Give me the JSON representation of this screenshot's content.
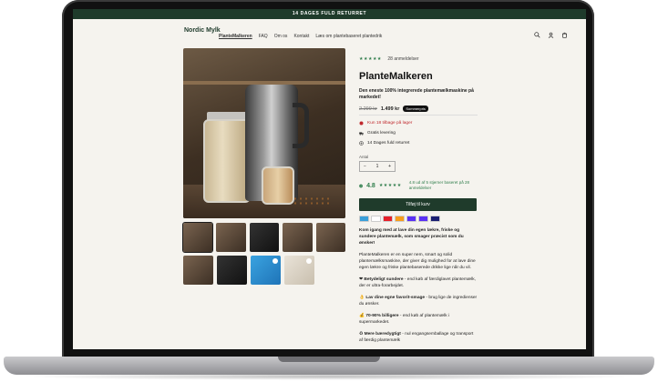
{
  "announcement": "14 DAGES FULD RETURRET",
  "logo": "Nordic Mylk",
  "nav": [
    "PlanteMalkeren",
    "FAQ",
    "Om os",
    "Kontakt",
    "Læs om plantebaseret plantedrik"
  ],
  "icons": [
    "search-icon",
    "account-icon",
    "cart-icon"
  ],
  "product": {
    "stars": "★★★★★",
    "review_count": "28 anmeldelser",
    "title": "PlanteMalkeren",
    "subtitle": "Den eneste 100% integrerede plantemælkmaskine på markedet!",
    "price_old": "2.299 kr",
    "price_new": "1.499 kr",
    "sale_badge": "Sommerpris",
    "features": [
      {
        "icon": "dot-icon",
        "text": "Kun 18 tilbage på lager"
      },
      {
        "icon": "truck-icon",
        "text": "Gratis levering"
      },
      {
        "icon": "return-icon",
        "text": "14 Dages fuld returret"
      }
    ],
    "quantity_label": "Antal",
    "quantity_value": "1",
    "rating_score": "4.8",
    "rating_stars": "★★★★★",
    "rating_text": "4.8 ud af 5 stjerner baseret på 28 anmeldelser",
    "cta_label": "Tilføj til kurv",
    "description_intro": "Kom igang med at lave din egen lækre, friske og sundere plantemælk, som smager præcist som du ønsker!",
    "description_p1": "PlanteMalkeren er en super nem, smart og solid plantemælksmaskine, der giver dig mulighed for at lave dine egen lækre og friske plantebaserede drikke lige når du vil.",
    "bullets": [
      {
        "title": "Betydeligt sundere",
        "text": " - end køb af færdiglavet plantemælk, der er ultra-forarbejdet."
      },
      {
        "title": "Lav dine egne favorit-smage",
        "text": " - brug lige de ingredienser du ønsker."
      },
      {
        "title": "70-90% billigere",
        "text": " - end køb af plantemælk i supermarkedet."
      },
      {
        "title": "Mere bæredygtigt",
        "text": " - nul engangsemballage og transport af færdig plantemælk"
      }
    ]
  },
  "colors": {
    "brand": "#1f3b2b",
    "accent": "#2f7d4b",
    "stock": "#c0282d"
  }
}
